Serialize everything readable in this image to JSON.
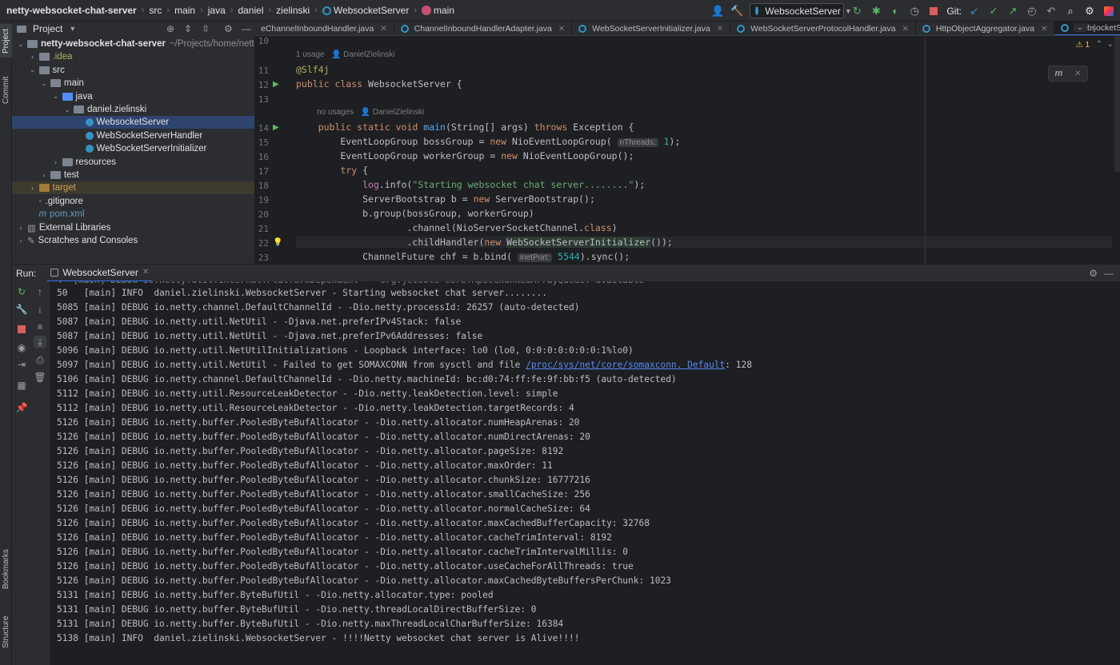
{
  "breadcrumb": [
    "netty-websocket-chat-server",
    "src",
    "main",
    "java",
    "daniel",
    "zielinski",
    "WebsocketServer",
    "main"
  ],
  "toolbar": {
    "run_config": "WebsocketServer",
    "git_label": "Git:"
  },
  "left_strip": {
    "project": "Project",
    "commit": "Commit",
    "bookmarks": "Bookmarks",
    "structure": "Structure"
  },
  "project": {
    "title": "Project",
    "tree": [
      {
        "label": "netty-websocket-chat-server",
        "extra": "~/Projects/home/nett",
        "kind": "module",
        "depth": 0,
        "open": true
      },
      {
        "label": ".idea",
        "kind": "folder",
        "depth": 1,
        "open": false,
        "color": "#b3ae60"
      },
      {
        "label": "src",
        "kind": "folder",
        "depth": 1,
        "open": true
      },
      {
        "label": "main",
        "kind": "folder",
        "depth": 2,
        "open": true
      },
      {
        "label": "java",
        "kind": "folder-blue",
        "depth": 3,
        "open": true
      },
      {
        "label": "daniel.zielinski",
        "kind": "package",
        "depth": 4,
        "open": true
      },
      {
        "label": "WebsocketServer",
        "kind": "class",
        "depth": 5,
        "selected": true
      },
      {
        "label": "WebSocketServerHandler",
        "kind": "class",
        "depth": 5
      },
      {
        "label": "WebSocketServerInitializer",
        "kind": "class",
        "depth": 5
      },
      {
        "label": "resources",
        "kind": "folder",
        "depth": 3,
        "open": false
      },
      {
        "label": "test",
        "kind": "folder",
        "depth": 2,
        "open": false
      },
      {
        "label": "target",
        "kind": "folder-orange",
        "depth": 1,
        "open": false,
        "highlight": true,
        "color": "#d0a257"
      },
      {
        "label": ".gitignore",
        "kind": "file",
        "depth": 1
      },
      {
        "label": "pom.xml",
        "kind": "maven",
        "depth": 1,
        "color": "#6897bb"
      },
      {
        "label": "External Libraries",
        "kind": "lib",
        "depth": 0,
        "open": false
      },
      {
        "label": "Scratches and Consoles",
        "kind": "scratch",
        "depth": 0,
        "open": false
      }
    ]
  },
  "tabs": [
    {
      "label": "eChannelInboundHandler.java"
    },
    {
      "label": "ChannelInboundHandlerAdapter.java"
    },
    {
      "label": "WebSocketServerInitializer.java"
    },
    {
      "label": "WebSocketServerProtocolHandler.java"
    },
    {
      "label": "HttpObjectAggregator.java"
    },
    {
      "label": "WebsocketServer.java",
      "active": true
    }
  ],
  "editor": {
    "warning_count": "1",
    "usage1": "1 usage",
    "author": "DanielZielinski",
    "usage2": "no usages",
    "line_numbers": [
      "10",
      "11",
      "12",
      "13",
      "14",
      "15",
      "16",
      "17",
      "18",
      "19",
      "20",
      "21",
      "22",
      "23"
    ],
    "hint_nthreads": "nThreads:",
    "hint_inetport": "inetPort:"
  },
  "run": {
    "label": "Run:",
    "tab": "WebsocketServer"
  },
  "console_lines": [
    {
      "ts": "50  ",
      "lvl": "INFO ",
      "logger": "daniel.zielinski.WebsocketServer",
      "msg": " - Starting websocket chat server........"
    },
    {
      "ts": "5085",
      "lvl": "DEBUG",
      "logger": "io.netty.channel.DefaultChannelId",
      "msg": " - -Dio.netty.processId: 26257 (auto-detected)"
    },
    {
      "ts": "5087",
      "lvl": "DEBUG",
      "logger": "io.netty.util.NetUtil",
      "msg": " - -Djava.net.preferIPv4Stack: false"
    },
    {
      "ts": "5087",
      "lvl": "DEBUG",
      "logger": "io.netty.util.NetUtil",
      "msg": " - -Djava.net.preferIPv6Addresses: false"
    },
    {
      "ts": "5096",
      "lvl": "DEBUG",
      "logger": "io.netty.util.NetUtilInitializations",
      "msg": " - Loopback interface: lo0 (lo0, 0:0:0:0:0:0:0:1%lo0)"
    },
    {
      "ts": "5097",
      "lvl": "DEBUG",
      "logger": "io.netty.util.NetUtil",
      "msg": " - Failed to get SOMAXCONN from sysctl and file ",
      "link": "/proc/sys/net/core/somaxconn. Default",
      "after": ": 128"
    },
    {
      "ts": "5106",
      "lvl": "DEBUG",
      "logger": "io.netty.channel.DefaultChannelId",
      "msg": " - -Dio.netty.machineId: bc:d0:74:ff:fe:9f:bb:f5 (auto-detected)"
    },
    {
      "ts": "5112",
      "lvl": "DEBUG",
      "logger": "io.netty.util.ResourceLeakDetector",
      "msg": " - -Dio.netty.leakDetection.level: simple"
    },
    {
      "ts": "5112",
      "lvl": "DEBUG",
      "logger": "io.netty.util.ResourceLeakDetector",
      "msg": " - -Dio.netty.leakDetection.targetRecords: 4"
    },
    {
      "ts": "5126",
      "lvl": "DEBUG",
      "logger": "io.netty.buffer.PooledByteBufAllocator",
      "msg": " - -Dio.netty.allocator.numHeapArenas: 20"
    },
    {
      "ts": "5126",
      "lvl": "DEBUG",
      "logger": "io.netty.buffer.PooledByteBufAllocator",
      "msg": " - -Dio.netty.allocator.numDirectArenas: 20"
    },
    {
      "ts": "5126",
      "lvl": "DEBUG",
      "logger": "io.netty.buffer.PooledByteBufAllocator",
      "msg": " - -Dio.netty.allocator.pageSize: 8192"
    },
    {
      "ts": "5126",
      "lvl": "DEBUG",
      "logger": "io.netty.buffer.PooledByteBufAllocator",
      "msg": " - -Dio.netty.allocator.maxOrder: 11"
    },
    {
      "ts": "5126",
      "lvl": "DEBUG",
      "logger": "io.netty.buffer.PooledByteBufAllocator",
      "msg": " - -Dio.netty.allocator.chunkSize: 16777216"
    },
    {
      "ts": "5126",
      "lvl": "DEBUG",
      "logger": "io.netty.buffer.PooledByteBufAllocator",
      "msg": " - -Dio.netty.allocator.smallCacheSize: 256"
    },
    {
      "ts": "5126",
      "lvl": "DEBUG",
      "logger": "io.netty.buffer.PooledByteBufAllocator",
      "msg": " - -Dio.netty.allocator.normalCacheSize: 64"
    },
    {
      "ts": "5126",
      "lvl": "DEBUG",
      "logger": "io.netty.buffer.PooledByteBufAllocator",
      "msg": " - -Dio.netty.allocator.maxCachedBufferCapacity: 32768"
    },
    {
      "ts": "5126",
      "lvl": "DEBUG",
      "logger": "io.netty.buffer.PooledByteBufAllocator",
      "msg": " - -Dio.netty.allocator.cacheTrimInterval: 8192"
    },
    {
      "ts": "5126",
      "lvl": "DEBUG",
      "logger": "io.netty.buffer.PooledByteBufAllocator",
      "msg": " - -Dio.netty.allocator.cacheTrimIntervalMillis: 0"
    },
    {
      "ts": "5126",
      "lvl": "DEBUG",
      "logger": "io.netty.buffer.PooledByteBufAllocator",
      "msg": " - -Dio.netty.allocator.useCacheForAllThreads: true"
    },
    {
      "ts": "5126",
      "lvl": "DEBUG",
      "logger": "io.netty.buffer.PooledByteBufAllocator",
      "msg": " - -Dio.netty.allocator.maxCachedByteBuffersPerChunk: 1023"
    },
    {
      "ts": "5131",
      "lvl": "DEBUG",
      "logger": "io.netty.buffer.ByteBufUtil",
      "msg": " - -Dio.netty.allocator.type: pooled"
    },
    {
      "ts": "5131",
      "lvl": "DEBUG",
      "logger": "io.netty.buffer.ByteBufUtil",
      "msg": " - -Dio.netty.threadLocalDirectBufferSize: 0"
    },
    {
      "ts": "5131",
      "lvl": "DEBUG",
      "logger": "io.netty.buffer.ByteBufUtil",
      "msg": " - -Dio.netty.maxThreadLocalCharBufferSize: 16384"
    },
    {
      "ts": "5138",
      "lvl": "INFO ",
      "logger": "daniel.zielinski.WebsocketServer",
      "msg": " - !!!!Netty websocket chat server is Alive!!!!"
    }
  ],
  "console_thread": "[main]",
  "colors": {
    "accent": "#3574f0",
    "selection": "#2e436e",
    "run_green": "#5fb865",
    "stop_red": "#db5c5c"
  }
}
